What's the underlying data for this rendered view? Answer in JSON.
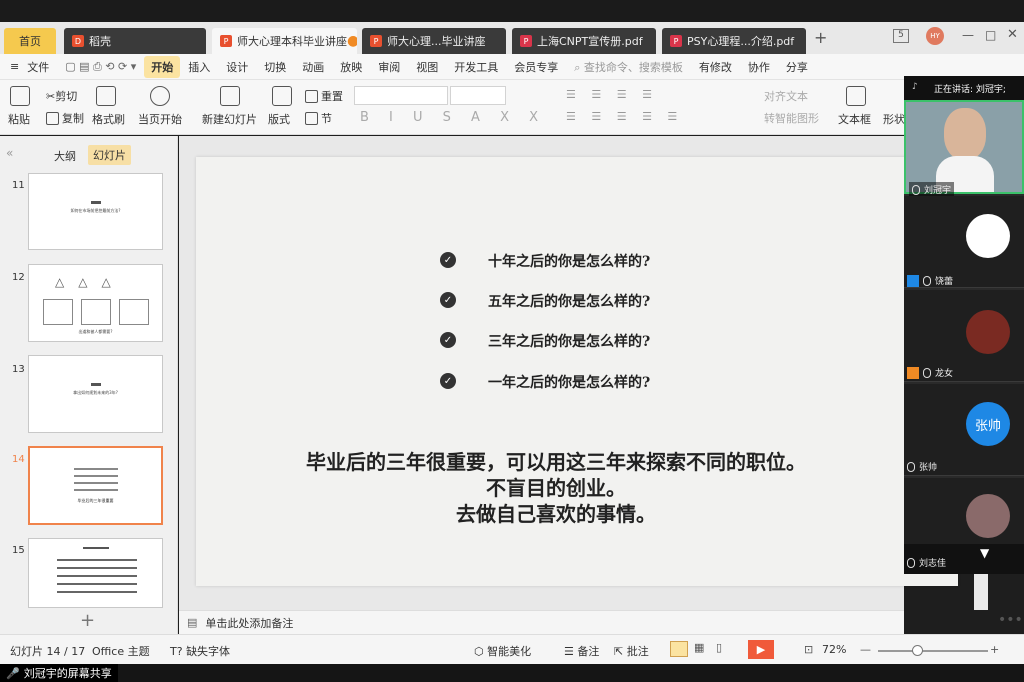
{
  "tabs": [
    {
      "label": "首页"
    },
    {
      "label": "稻壳"
    },
    {
      "label": "师大心理本科毕业讲座"
    },
    {
      "label": "师大心理...毕业讲座"
    },
    {
      "label": "上海CNPT宣传册.pdf"
    },
    {
      "label": "PSY心理程...介绍.pdf"
    }
  ],
  "tab_add": "+",
  "window_buttons": {
    "count": "5",
    "user": "HY"
  },
  "menu": {
    "file": "文件",
    "items": [
      "开始",
      "插入",
      "设计",
      "切换",
      "动画",
      "放映",
      "审阅",
      "视图",
      "开发工具",
      "会员专享"
    ],
    "search_placeholder": "查找命令、搜索模板",
    "revise": "有修改",
    "collab": "协作",
    "share": "分享"
  },
  "ribbon": {
    "paste": "粘贴",
    "cut": "剪切",
    "copy": "复制",
    "format_painter": "格式刷",
    "from_start": "当页开始",
    "new_slide": "新建幻灯片",
    "layout": "版式",
    "reset": "重置",
    "section": "节",
    "align_text": "对齐文本",
    "to_smartart": "转智能图形",
    "textbox": "文本框",
    "shape": "形状"
  },
  "panel_tabs": {
    "outline": "大纲",
    "slides": "幻灯片"
  },
  "thumbnails": [
    {
      "num": "11",
      "text": "如何在市场前把控最前方法?"
    },
    {
      "num": "12",
      "text": "出道和被人都需要?"
    },
    {
      "num": "13",
      "text": "拿出如何规划未来的3年?"
    },
    {
      "num": "14",
      "text": "毕业后的三年很重要"
    },
    {
      "num": "15",
      "text": ""
    }
  ],
  "add_slide": "+",
  "slide": {
    "bullets": [
      "十年之后的你是怎么样的?",
      "五年之后的你是怎么样的?",
      "三年之后的你是怎么样的?",
      "一年之后的你是怎么样的?"
    ],
    "main_lines": [
      "毕业后的三年很重要，可以用这三年来探索不同的职位。",
      "不盲目的创业。",
      "去做自己喜欢的事情。"
    ]
  },
  "notes_placeholder": "单击此处添加备注",
  "status": {
    "slide_count": "幻灯片 14 / 17",
    "theme": "Office 主题",
    "missing_font": "缺失字体",
    "beautify": "智能美化",
    "notes": "备注",
    "comments": "批注",
    "zoom": "72%"
  },
  "meeting": {
    "speaking": "正在讲话: 刘冠宇;",
    "participants": [
      {
        "name": "刘冠宇"
      },
      {
        "name": "饶蕾"
      },
      {
        "name": "龙女"
      },
      {
        "name": "张帅",
        "avatar_text": "张帅"
      },
      {
        "name": "刘志佳"
      }
    ],
    "share_label": "刘冠宇的屏幕共享"
  },
  "colors": {
    "accent": "#f0834b",
    "tab_home": "#f5c94e",
    "play": "#f05a3a",
    "avatar_blue": "#1e88e5"
  }
}
